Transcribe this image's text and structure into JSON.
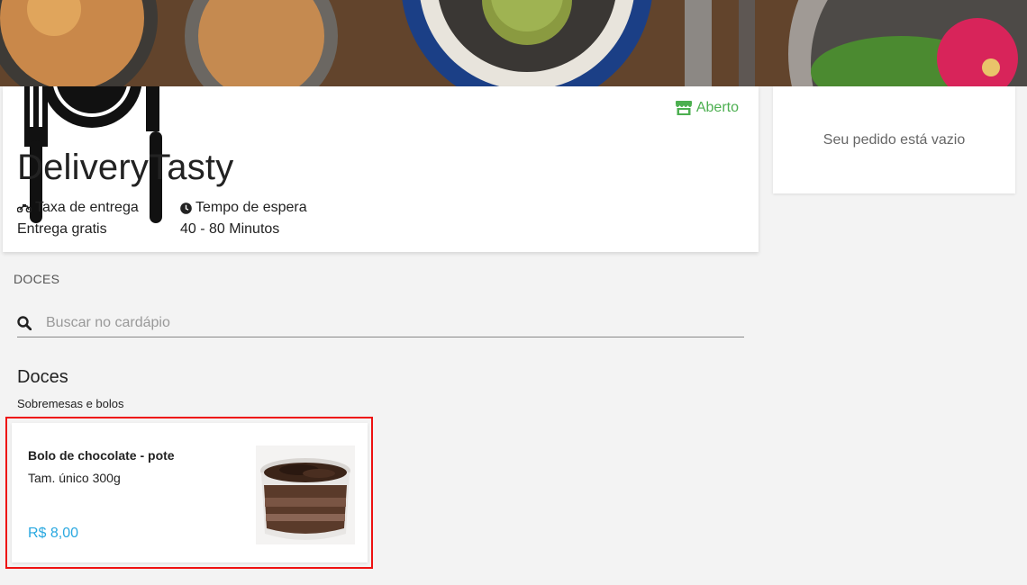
{
  "restaurant": {
    "name": "DeliveryTasty",
    "status": "Aberto",
    "delivery_fee_label": "Taxa de entrega",
    "delivery_fee_value": "Entrega gratis",
    "wait_time_label": "Tempo de espera",
    "wait_time_value": "40 - 80 Minutos"
  },
  "order": {
    "empty_message": "Seu pedido está vazio"
  },
  "menu": {
    "category_nav": "DOCES",
    "search_placeholder": "Buscar no cardápio",
    "section_title": "Doces",
    "section_description": "Sobremesas e bolos",
    "products": [
      {
        "name": "Bolo de chocolate - pote",
        "description": "Tam. único 300g",
        "price": "R$ 8,00"
      }
    ]
  },
  "colors": {
    "accent_green": "#4caf50",
    "price_blue": "#29a8e0",
    "highlight_red": "#ee1111"
  }
}
